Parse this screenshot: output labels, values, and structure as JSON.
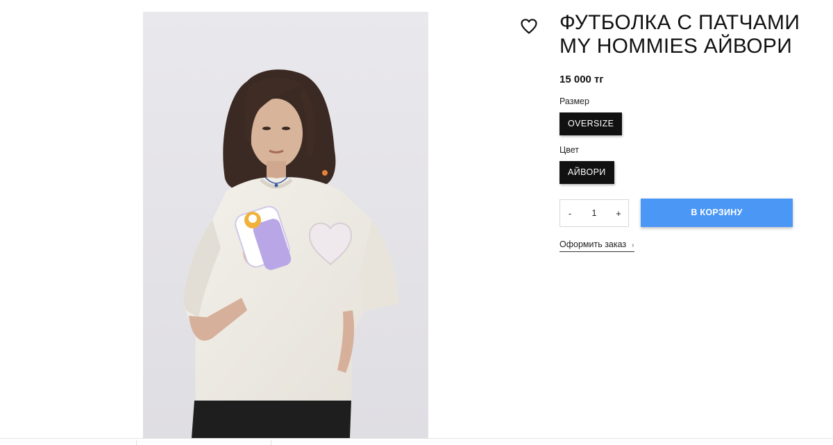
{
  "product": {
    "title": "ФУТБОЛКА С ПАТЧАМИ MY HOMMIES АЙВОРИ",
    "price": "15 000 тг",
    "size": {
      "label": "Размер",
      "selected": "OVERSIZE"
    },
    "color": {
      "label": "Цвет",
      "selected": "АЙВОРИ"
    },
    "quantity": {
      "minus": "-",
      "value": "1",
      "plus": "+"
    },
    "add_to_cart": "В КОРЗИНУ",
    "checkout_link": "Оформить заказ",
    "checkout_chevron": "›"
  },
  "icons": {
    "favorite": "heart-icon",
    "checkout": "chevron-right-icon"
  },
  "colors": {
    "accent": "#4a97f6",
    "option_bg": "#111111",
    "photo_bg": "#ebeaee"
  }
}
